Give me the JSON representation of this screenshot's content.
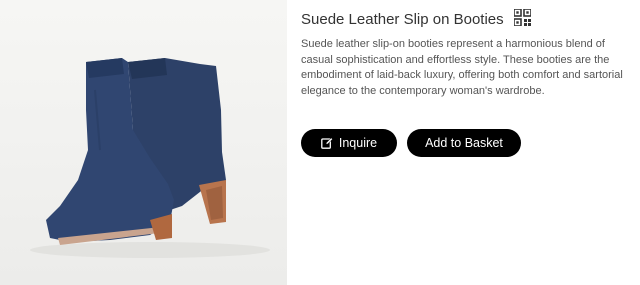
{
  "product": {
    "title": "Suede Leather Slip on Booties",
    "description": "Suede leather slip-on booties represent a harmonious blend of casual sophistication and effortless style. These booties are the embodiment of laid-back luxury, offering both comfort and sartorial elegance to the contemporary woman's wardrobe.",
    "image_subject": "navy suede ankle boots",
    "colors": {
      "boot": "#2b3f66",
      "heel": "#b06a44",
      "button_bg": "#000000",
      "button_text": "#ffffff"
    }
  },
  "icons": {
    "qr": "qr-code-icon",
    "edit": "edit-icon"
  },
  "actions": {
    "inquire_label": "Inquire",
    "basket_label": "Add to Basket"
  }
}
